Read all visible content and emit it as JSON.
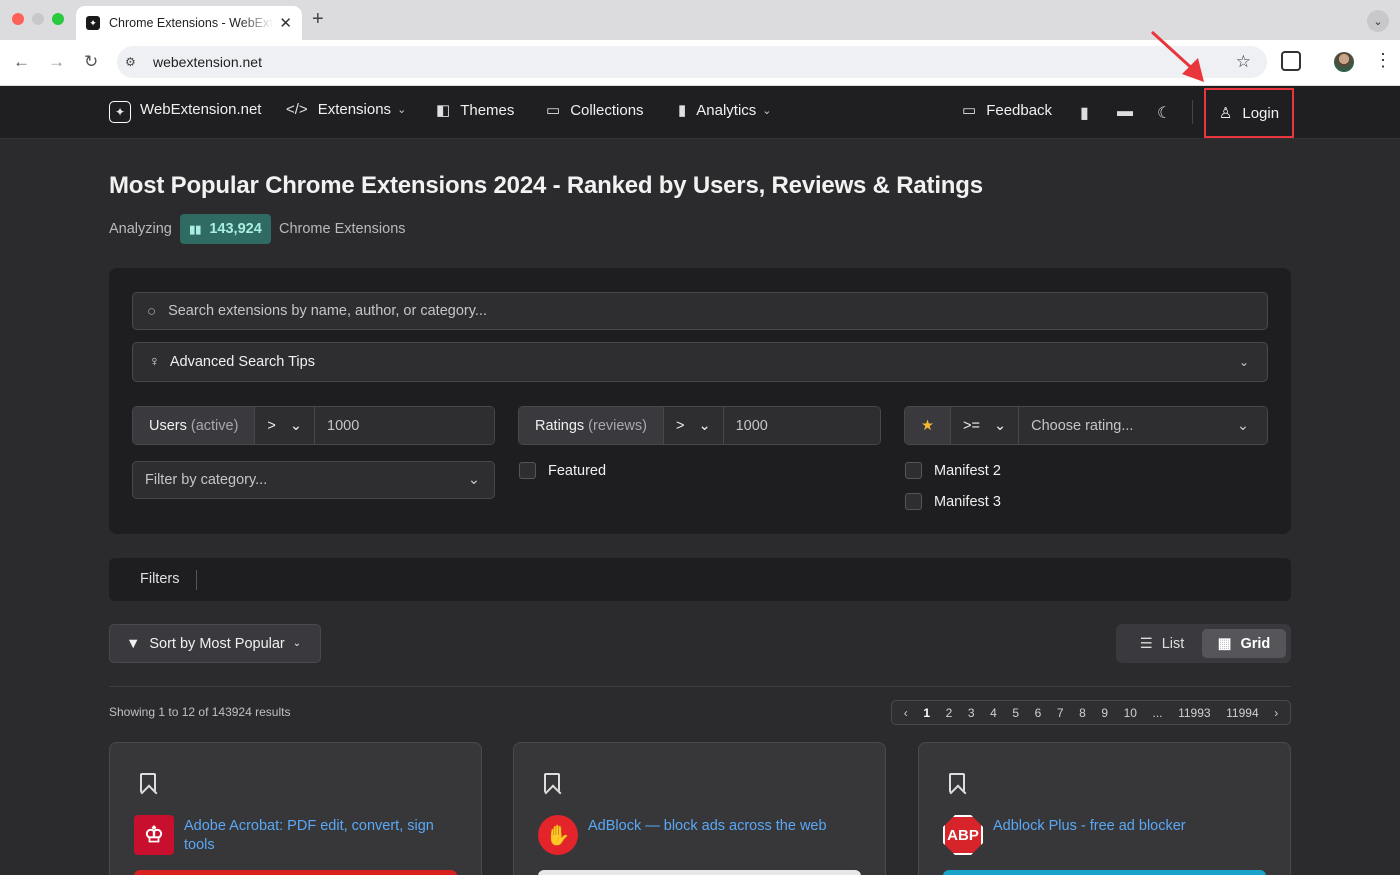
{
  "browser": {
    "tab_title": "Chrome Extensions - WebExtension.net",
    "tab_close": "✕",
    "new_tab": "+",
    "url": "webextension.net"
  },
  "nav": {
    "brand": "WebExtension.net",
    "extensions": "Extensions",
    "themes": "Themes",
    "collections": "Collections",
    "analytics": "Analytics",
    "feedback": "Feedback",
    "login": "Login"
  },
  "header": {
    "title": "Most Popular Chrome Extensions 2024 - Ranked by Users, Reviews & Ratings",
    "analyzing": "Analyzing",
    "count": "143,924",
    "suffix": "Chrome Extensions"
  },
  "filters": {
    "search_placeholder": "Search extensions by name, author, or category...",
    "tips": "Advanced Search Tips",
    "users_label": "Users",
    "users_sub": "(active)",
    "users_op": ">",
    "users_value": "1000",
    "ratings_label": "Ratings",
    "ratings_sub": "(reviews)",
    "ratings_op": ">",
    "ratings_value": "1000",
    "rating_op": ">=",
    "rating_placeholder": "Choose rating...",
    "category_placeholder": "Filter by category...",
    "featured": "Featured",
    "manifest2": "Manifest 2",
    "manifest3": "Manifest 3",
    "filters_label": "Filters"
  },
  "controls": {
    "sort": "Sort by Most Popular",
    "list": "List",
    "grid": "Grid",
    "showing": "Showing 1 to 12 of 143924 results"
  },
  "pager": {
    "prev": "‹",
    "pages": [
      "1",
      "2",
      "3",
      "4",
      "5",
      "6",
      "7",
      "8",
      "9",
      "10",
      "...",
      "11993",
      "11994"
    ],
    "next": "›"
  },
  "cards": [
    {
      "name": "Adobe Acrobat: PDF edit, convert, sign tools",
      "logo_color": "#c8102e",
      "strip_color": "#d8201e"
    },
    {
      "name": "AdBlock — block ads across the web",
      "logo_color": "#e3242b",
      "strip_color": "#e8e8ea"
    },
    {
      "name": "Adblock Plus - free ad blocker",
      "logo_color": "#d6242a",
      "logo_text": "ABP",
      "strip_color": "#1aa3c8"
    }
  ],
  "colors": {
    "accent_badge": "#2f6b62",
    "link": "#5aa8f5",
    "highlight": "#e8363c"
  }
}
